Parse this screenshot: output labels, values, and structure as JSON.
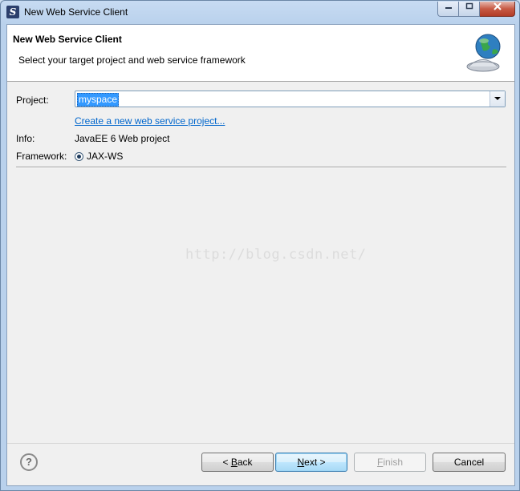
{
  "window": {
    "title": "New Web Service Client",
    "controls": {
      "minimize": "▭",
      "maximize": "□",
      "close": "✕"
    }
  },
  "banner": {
    "title": "New Web Service Client",
    "description": "Select your target project and web service framework",
    "icon": "web-service-globe-icon"
  },
  "form": {
    "project_label": "Project:",
    "project_value": "myspace",
    "create_link": "Create a new web service project...",
    "info_label": "Info:",
    "info_value": "JavaEE 6 Web project",
    "framework_label": "Framework:",
    "framework_option": "JAX-WS",
    "framework_selected": true
  },
  "watermark": "http://blog.csdn.net/",
  "footer": {
    "help_glyph": "?",
    "back": {
      "prefix": "< ",
      "mnemonic": "B",
      "rest": "ack"
    },
    "next": {
      "mnemonic": "N",
      "rest": "ext >"
    },
    "finish": {
      "mnemonic": "F",
      "rest": "inish",
      "enabled": false
    },
    "cancel": "Cancel"
  },
  "colors": {
    "link": "#0066cc",
    "selection": "#3399ff",
    "close_button": "#c75a44"
  }
}
